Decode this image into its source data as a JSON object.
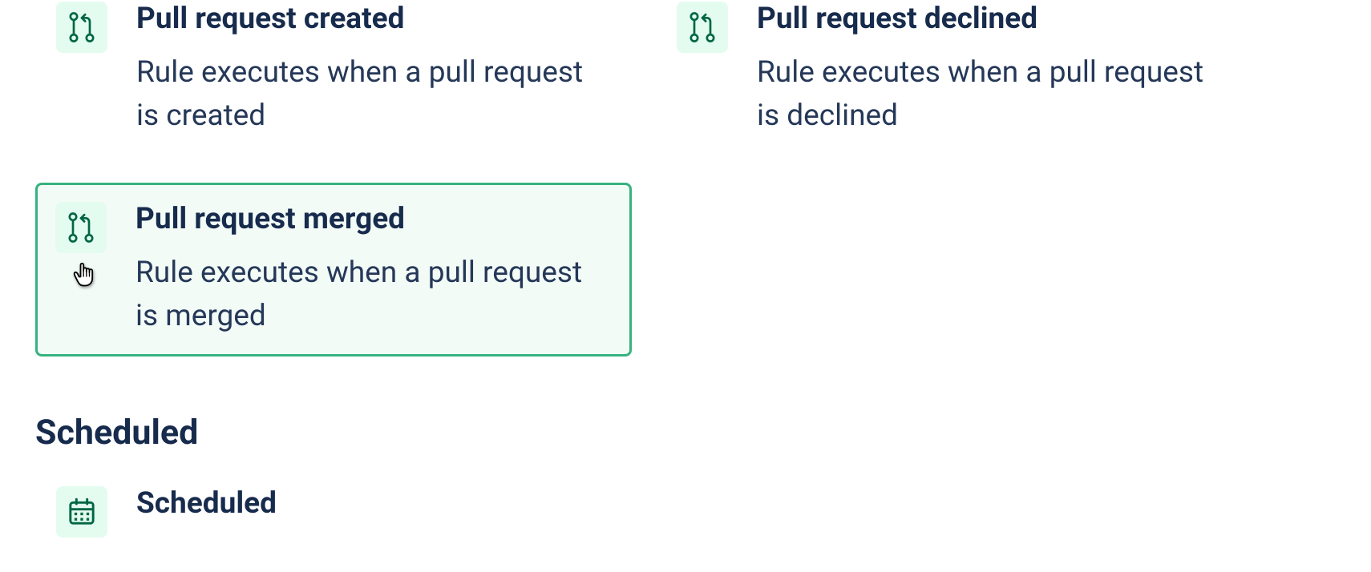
{
  "triggers": {
    "pr_created": {
      "title": "Pull request created",
      "desc": "Rule executes when a pull request is created"
    },
    "pr_declined": {
      "title": "Pull request declined",
      "desc": "Rule executes when a pull request is declined"
    },
    "pr_merged": {
      "title": "Pull request merged",
      "desc": "Rule executes when a pull request is merged"
    }
  },
  "sections": {
    "scheduled": {
      "header": "Scheduled",
      "items": {
        "scheduled": {
          "title": "Scheduled"
        }
      }
    }
  },
  "colors": {
    "accent": "#36b37e",
    "accent_bg": "#e3fcef",
    "selected_bg": "#f3fbf7",
    "text_primary": "#172b4d",
    "text_secondary": "#253858",
    "icon_stroke": "#006644"
  }
}
